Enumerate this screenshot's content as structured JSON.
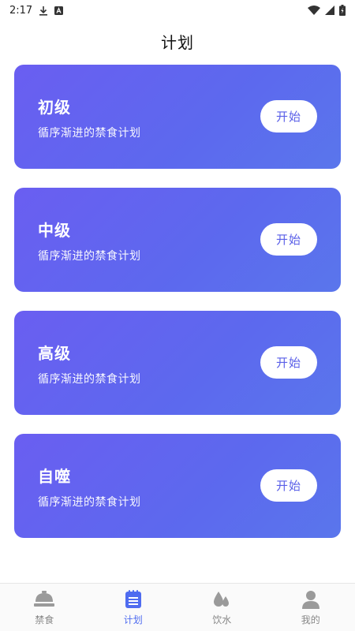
{
  "status_bar": {
    "time": "2:17"
  },
  "header": {
    "title": "计划"
  },
  "plans": [
    {
      "name": "初级",
      "description": "循序渐进的禁食计划",
      "button": "开始"
    },
    {
      "name": "中级",
      "description": "循序渐进的禁食计划",
      "button": "开始"
    },
    {
      "name": "高级",
      "description": "循序渐进的禁食计划",
      "button": "开始"
    },
    {
      "name": "自噬",
      "description": "循序渐进的禁食计划",
      "button": "开始"
    }
  ],
  "bottom_nav": {
    "items": [
      {
        "label": "禁食",
        "icon": "bowl-icon",
        "active": false
      },
      {
        "label": "计划",
        "icon": "list-icon",
        "active": true
      },
      {
        "label": "饮水",
        "icon": "water-drop-icon",
        "active": false
      },
      {
        "label": "我的",
        "icon": "person-icon",
        "active": false
      }
    ]
  },
  "colors": {
    "card_gradient_start": "#6a5ef1",
    "card_gradient_end": "#5a76ec",
    "accent": "#4f6cf0",
    "inactive": "#888888"
  }
}
